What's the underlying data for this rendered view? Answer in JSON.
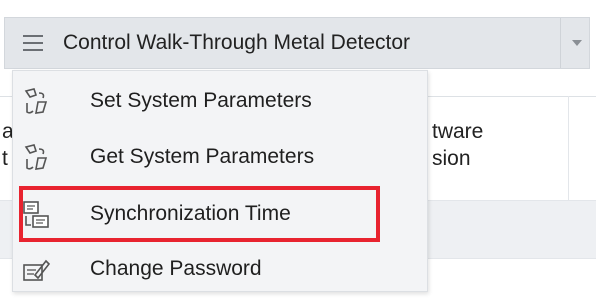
{
  "toolbar": {
    "control_label": "Control Walk-Through Metal Detector",
    "menu_icon": "hamburger-menu-icon",
    "dropdown_icon": "caret-down-icon"
  },
  "table": {
    "header_left_fragment_top": "a",
    "header_left_fragment_bottom": "t",
    "header_col2_top": "tware",
    "header_col2_bottom": "sion"
  },
  "menu": {
    "items": [
      {
        "label": "Set System Parameters",
        "icon": "settings-set-icon"
      },
      {
        "label": "Get System Parameters",
        "icon": "settings-get-icon"
      },
      {
        "label": "Synchronization Time",
        "icon": "sync-time-icon"
      },
      {
        "label": "Change Password",
        "icon": "change-password-icon"
      }
    ],
    "highlighted_item_index": 2
  },
  "colors": {
    "highlight_border": "#e8232f",
    "toolbar_bg": "#e3e6ea",
    "menu_bg": "#f3f4f6"
  }
}
